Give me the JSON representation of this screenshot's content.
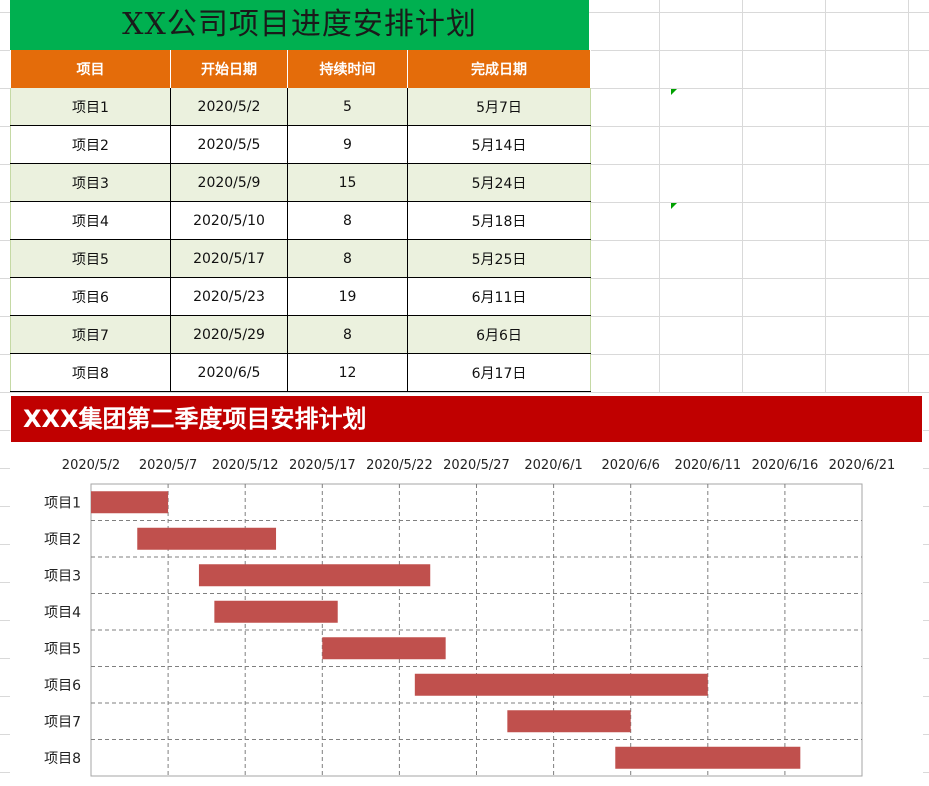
{
  "sheet": {
    "title": "XX公司项目进度安排计划",
    "headers": [
      "项目",
      "开始日期",
      "持续时间",
      "完成日期"
    ],
    "rows": [
      [
        "项目1",
        "2020/5/2",
        "5",
        "5月7日"
      ],
      [
        "项目2",
        "2020/5/5",
        "9",
        "5月14日"
      ],
      [
        "项目3",
        "2020/5/9",
        "15",
        "5月24日"
      ],
      [
        "项目4",
        "2020/5/10",
        "8",
        "5月18日"
      ],
      [
        "项目5",
        "2020/5/17",
        "8",
        "5月25日"
      ],
      [
        "项目6",
        "2020/5/23",
        "19",
        "6月11日"
      ],
      [
        "项目7",
        "2020/5/29",
        "8",
        "6月6日"
      ],
      [
        "项目8",
        "2020/6/5",
        "12",
        "6月17日"
      ]
    ]
  },
  "colors": {
    "title_bg": "#00b050",
    "header_bg": "#e46c0a",
    "band_row": "#ebf1de",
    "chart_title_bg": "#c00000",
    "bar": "#c0504d"
  },
  "chart_data": {
    "type": "bar",
    "orientation": "horizontal-gantt",
    "title": "XXX集团第二季度项目安排计划",
    "categories": [
      "项目1",
      "项目2",
      "项目3",
      "项目4",
      "项目5",
      "项目6",
      "项目7",
      "项目8"
    ],
    "start": [
      "2020/5/2",
      "2020/5/5",
      "2020/5/9",
      "2020/5/10",
      "2020/5/17",
      "2020/5/23",
      "2020/5/29",
      "2020/6/5"
    ],
    "duration_days": [
      5,
      9,
      15,
      8,
      8,
      19,
      8,
      12
    ],
    "xticks": [
      "2020/5/2",
      "2020/5/7",
      "2020/5/12",
      "2020/5/17",
      "2020/5/22",
      "2020/5/27",
      "2020/6/1",
      "2020/6/6",
      "2020/6/11",
      "2020/6/16",
      "2020/6/21"
    ],
    "xlim": [
      "2020/5/2",
      "2020/6/21"
    ],
    "x_axis_position": "top",
    "grid": true
  }
}
